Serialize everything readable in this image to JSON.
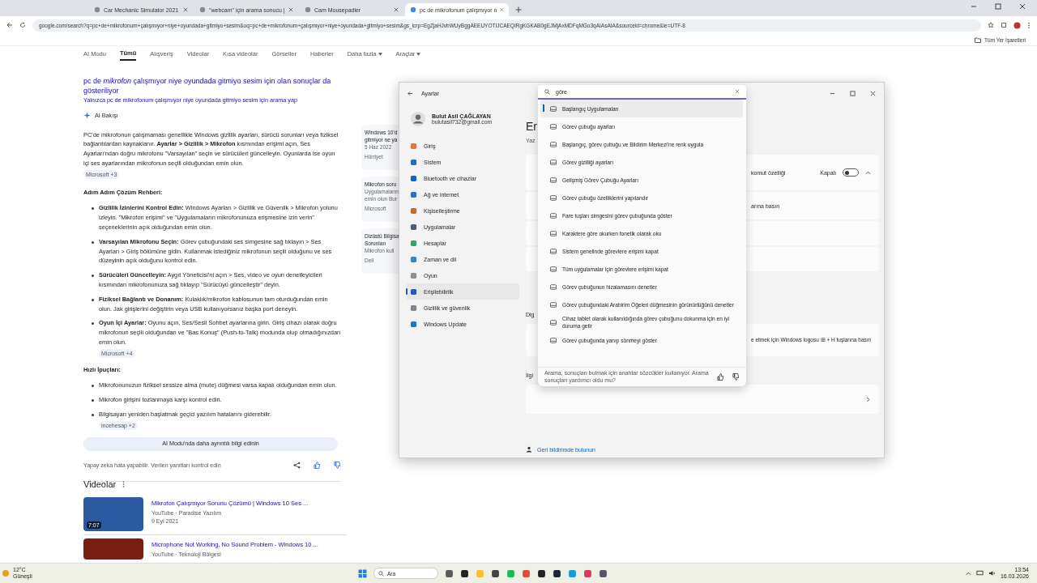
{
  "browser": {
    "tabs": [
      {
        "title": "Car Mechanic Simulator 2021",
        "selected": false
      },
      {
        "title": "\"webcam\" için arama sonucu |",
        "selected": false
      },
      {
        "title": "Cam Mousepadler",
        "selected": false
      },
      {
        "title": "pc de mikrofonum çalışmıyor n",
        "selected": true
      }
    ],
    "url": "google.com/search?q=pc+de+mikrofonum+çalışmıyor+niye+oyundada+gitmiyo+sesim&oq=pc+de+mikrofonum+çalışmıyor+niye+oyundada+gitmiyo+sesim&gs_lcrp=EgZjaHJvbWUyBggAEEUYOTIJCAEQIRgKGKAB0gEJMjAxMDFqMGo3qAIAsAIA&sourceid=chrome&ie=UTF-8",
    "bookmarks": "Tüm Yer İşaretleri"
  },
  "search_tabs": [
    {
      "label": "AI Modu",
      "selected": false,
      "dropdown": false
    },
    {
      "label": "Tümü",
      "selected": true,
      "dropdown": false
    },
    {
      "label": "Alışveriş",
      "selected": false,
      "dropdown": false
    },
    {
      "label": "Videolar",
      "selected": false,
      "dropdown": false
    },
    {
      "label": "Kısa videolar",
      "selected": false,
      "dropdown": false
    },
    {
      "label": "Görseller",
      "selected": false,
      "dropdown": false
    },
    {
      "label": "Haberler",
      "selected": false,
      "dropdown": false
    },
    {
      "label": "Daha fazla",
      "selected": false,
      "dropdown": true
    },
    {
      "label": "Araçlar",
      "selected": false,
      "dropdown": true
    }
  ],
  "spelling": {
    "showing": "pc de *mikrofon* çalışmıyor niye oyundada gitmiyo sesim için olan sonuçlar da gösteriliyor",
    "only": "Yalnızca pc de mikrofonum çalışmıyor niye oyundada gitmiyo sesim için arama yap"
  },
  "ai_overview": {
    "label": "AI Bakışı",
    "intro": {
      "text": "PC'de mikrofonun çalışmaması genellikle Windows gizlilik ayarları, sürücü sorunları veya fiziksel bağlantılardan kaynaklanır. **Ayarlar > Gizlilik > Mikrofon** kısmından erişimi açın, Ses Ayarları'ndan doğru mikrofonu \"Varsayılan\" seçin ve sürücüleri güncelleyin. Oyunlarda ise oyun içi ses ayarlarından mikrofonun seçili olduğundan emin olun.",
      "source": "Microsoft +3"
    },
    "sections": [
      {
        "heading": "Adım Adım Çözüm Rehberi:",
        "items": [
          {
            "text": "**Gizlilik İzinlerini Kontrol Edin:** Windows Ayarları > Gizlilik ve Güvenlik > Mikrofon yolunu izleyin. \"Mikrofon erişimi\" ve \"Uygulamaların mikrofonunuza erişmesine izin verin\" seçeneklerinin açık olduğundan emin olun."
          },
          {
            "text": "**Varsayılan Mikrofonu Seçin:** Görev çubuğundaki ses simgesine sağ tıklayın > Ses Ayarları > Giriş bölümüne gidin. Kullanmak istediğiniz mikrofonun seçili olduğunu ve ses düzeyinin açık olduğunu kontrol edin."
          },
          {
            "text": "**Sürücüleri Güncelleyin:** Aygıt Yöneticisi'ni açın > Ses, video ve oyun denetleyicileri kısmından mikrofonunuza sağ tıklayıp \"Sürücüyü güncelleştir\" deyin."
          },
          {
            "text": "**Fiziksel Bağlantı ve Donanım:** Kulaklık/mikrofon kablosunun tam oturduğundan emin olun. Jak girişlerini değiştirin veya USB kullanıyorsanız başka port deneyin."
          },
          {
            "text": "**Oyun İçi Ayarlar:** Oyunu açın, Ses/Sesli Sohbet ayarlarına girin. Giriş cihazı olarak doğru mikrofonun seçili olduğundan ve \"Bas Konuş\" (Push-to-Talk) modunda olup olmadığınızdan emin olun.",
            "source": "Microsoft +4"
          }
        ]
      },
      {
        "heading": "Hızlı İpuçları:",
        "items": [
          {
            "text": "Mikrofonunuzun fiziksel sessize alma (mute) düğmesi varsa kapalı olduğundan emin olun."
          },
          {
            "text": "Mikrofon girişini tozlanmaya karşı kontrol edin."
          },
          {
            "text": "Bilgisayarı yeniden başlatmak geçici yazılım hatalarını giderebilir.",
            "source": "incehesap +2"
          }
        ]
      }
    ],
    "more_button": "AI Modu'nda daha ayrıntılı bilgi edinin",
    "disclaimer": "Yapay zeka hata yapabilir. Verilen yanıtları kontrol edin"
  },
  "side_cards": [
    {
      "lines": [
        "Windows 10'd",
        "gitmiyor ne ya"
      ],
      "date": "5 Haz 2022",
      "source": "Hürriyet"
    },
    {
      "lines": [
        "Mikrofon soru"
      ],
      "snippet": [
        "Uygulamaların",
        "emin olun Bur"
      ],
      "source": "Microsoft"
    },
    {
      "lines": [
        "Dizüstü Bilgisa",
        "Sorunları"
      ],
      "snippet": [
        "Mikrofon kull"
      ],
      "source": "Dell"
    }
  ],
  "videos": {
    "title": "Videolar",
    "items": [
      {
        "title": "Mikrofon Çalışmıyor Sorunu Çözümü | Windows 10 Ses ...",
        "duration": "7:07",
        "channel": "YouTube · Paradise Yazılım",
        "date": "9 Eyl 2021"
      },
      {
        "title": "Microphone Not Working, No Sound Problem - Windows 10 ...",
        "channel": "YouTube · Teknoloji Bölgesi"
      }
    ]
  },
  "settings": {
    "title": "Ayarlar",
    "user": {
      "name": "Bulut Asil ÇAĞLAYAN",
      "email": "bulutasil732@gmail.com"
    },
    "nav": [
      {
        "label": "Giriş",
        "selected": false
      },
      {
        "label": "Sistem",
        "selected": false
      },
      {
        "label": "Bluetooth ve cihazlar",
        "selected": false
      },
      {
        "label": "Ağ ve internet",
        "selected": false
      },
      {
        "label": "Kişiselleştirme",
        "selected": false
      },
      {
        "label": "Uygulamalar",
        "selected": false
      },
      {
        "label": "Hesaplar",
        "selected": false
      },
      {
        "label": "Zaman ve dil",
        "selected": false
      },
      {
        "label": "Oyun",
        "selected": false
      },
      {
        "label": "Erişilebilirlik",
        "selected": true
      },
      {
        "label": "Gizlilik ve güvenlik",
        "selected": false
      },
      {
        "label": "Windows Update",
        "selected": false
      }
    ],
    "search": {
      "value": "göre",
      "results": [
        {
          "label": "Başlangıç Uygulamaları",
          "selected": true
        },
        {
          "label": "Görev çubuğu ayarları",
          "selected": false
        },
        {
          "label": "Başlangıç, görev çubuğu ve Bildirim Merkezi'ne renk uygula",
          "selected": false
        },
        {
          "label": "Görev gizliliği ayarları",
          "selected": false
        },
        {
          "label": "Gelişmiş Görev Çubuğu Ayarları",
          "selected": false
        },
        {
          "label": "Görev çubuğu özelliklerini yapılandır",
          "selected": false
        },
        {
          "label": "Fare tuşları simgesini görev çubuğunda göster",
          "selected": false
        },
        {
          "label": "Karaktere göre okurken fonetik olarak oku",
          "selected": false
        },
        {
          "label": "Sistem genelinde görevlere erişimi kapat",
          "selected": false
        },
        {
          "label": "Tüm uygulamalar için görevlere erişimi kapat",
          "selected": false
        },
        {
          "label": "Görev çubuğunun hizalamasını denetler",
          "selected": false
        },
        {
          "label": "Görev çubuğundaki Arabirim Öğeleri düğmesinin görünürlüğünü denetler",
          "selected": false
        },
        {
          "label": "Cihaz tablet olarak kullanıldığında görev çubuğunu dokunma için en iyi duruma getir",
          "selected": false
        },
        {
          "label": "Görev çubuğunda yanıp sönmeyi göster",
          "selected": false
        }
      ],
      "feedback": "Arama, sonuçları bulmak için anahtar sözcükler kullanıyor. Arama sonuçları yardımcı oldu mu?"
    },
    "page": {
      "heading": "Er",
      "subtitle": "Yaz",
      "card": {
        "text": "komut özelliği",
        "state": "Kapalı",
        "on": false,
        "expanded": true
      },
      "row": "arına basın",
      "section1": "Dig",
      "card2": "e etmek için Windows logosu ⊞ + H tuşlarına basın",
      "section2": "İlgi",
      "feedback_link": "Geri bildirimde bulunun"
    }
  },
  "taskbar": {
    "temperature": "12°C",
    "weather": "Güneşli",
    "search": "Ara",
    "time": "13:54",
    "date": "16.03.2026"
  }
}
